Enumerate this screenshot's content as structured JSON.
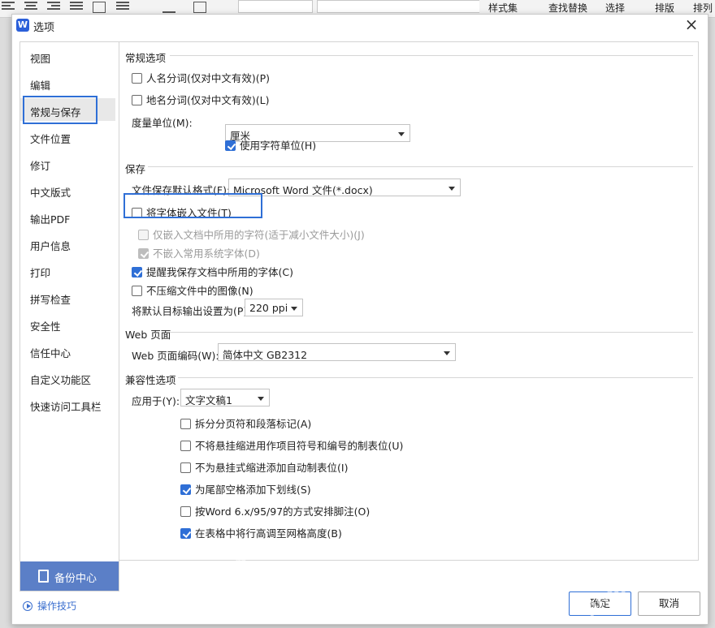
{
  "toolbar": {
    "style_set": "样式集",
    "find_replace": "查找替换",
    "select": "选择",
    "layout": "排版",
    "arrange": "排列"
  },
  "dialog": {
    "title": "选项",
    "close_label": "×"
  },
  "sidebar": {
    "items": [
      "视图",
      "编辑",
      "常规与保存",
      "文件位置",
      "修订",
      "中文版式",
      "输出PDF",
      "用户信息",
      "打印",
      "拼写检查",
      "安全性",
      "信任中心",
      "自定义功能区",
      "快速访问工具栏"
    ],
    "active": "常规与保存",
    "backup_label": "备份中心",
    "tips_label": "操作技巧"
  },
  "general": {
    "section_title": "常规选项",
    "person_name": {
      "label": "人名分词(仅对中文有效)(P)",
      "checked": false
    },
    "place_name": {
      "label": "地名分词(仅对中文有效)(L)",
      "checked": false
    },
    "unit_label": "度量单位(M):",
    "unit_value": "厘米",
    "char_unit": {
      "label": "使用字符单位(H)",
      "checked": true
    }
  },
  "save": {
    "section_title": "保存",
    "format_label": "文件保存默认格式(F):",
    "format_value": "Microsoft Word 文件(*.docx)",
    "embed_fonts": {
      "label": "将字体嵌入文件(T)",
      "checked": false
    },
    "embed_used_only": {
      "label": "仅嵌入文档中所用的字符(适于减小文件大小)(J)",
      "checked": false
    },
    "no_embed_common": {
      "label": "不嵌入常用系统字体(D)",
      "checked": true
    },
    "remind_fonts": {
      "label": "提醒我保存文档中所用的字体(C)",
      "checked": true
    },
    "no_compress": {
      "label": "不压缩文件中的图像(N)",
      "checked": false
    },
    "ppi_label": "将默认目标输出设置为(P):",
    "ppi_value": "220 ppi"
  },
  "web": {
    "section_title": "Web 页面",
    "encoding_label": "Web 页面编码(W):",
    "encoding_value": "简体中文 GB2312"
  },
  "compat": {
    "section_title": "兼容性选项",
    "apply_label": "应用于(Y):",
    "apply_value": "文字文稿1",
    "options": [
      {
        "label": "拆分分页符和段落标记(A)",
        "checked": false
      },
      {
        "label": "不将悬挂缩进用作项目符号和编号的制表位(U)",
        "checked": false
      },
      {
        "label": "不为悬挂式缩进添加自动制表位(I)",
        "checked": false
      },
      {
        "label": "为尾部空格添加下划线(S)",
        "checked": true
      },
      {
        "label": "按Word 6.x/95/97的方式安排脚注(O)",
        "checked": false
      },
      {
        "label": "在表格中将行高调至网格高度(B)",
        "checked": true
      }
    ]
  },
  "buttons": {
    "ok": "确定",
    "cancel": "取消"
  },
  "colors": {
    "accent": "#2f6fd6",
    "backup_bg": "#5b7fc7"
  }
}
